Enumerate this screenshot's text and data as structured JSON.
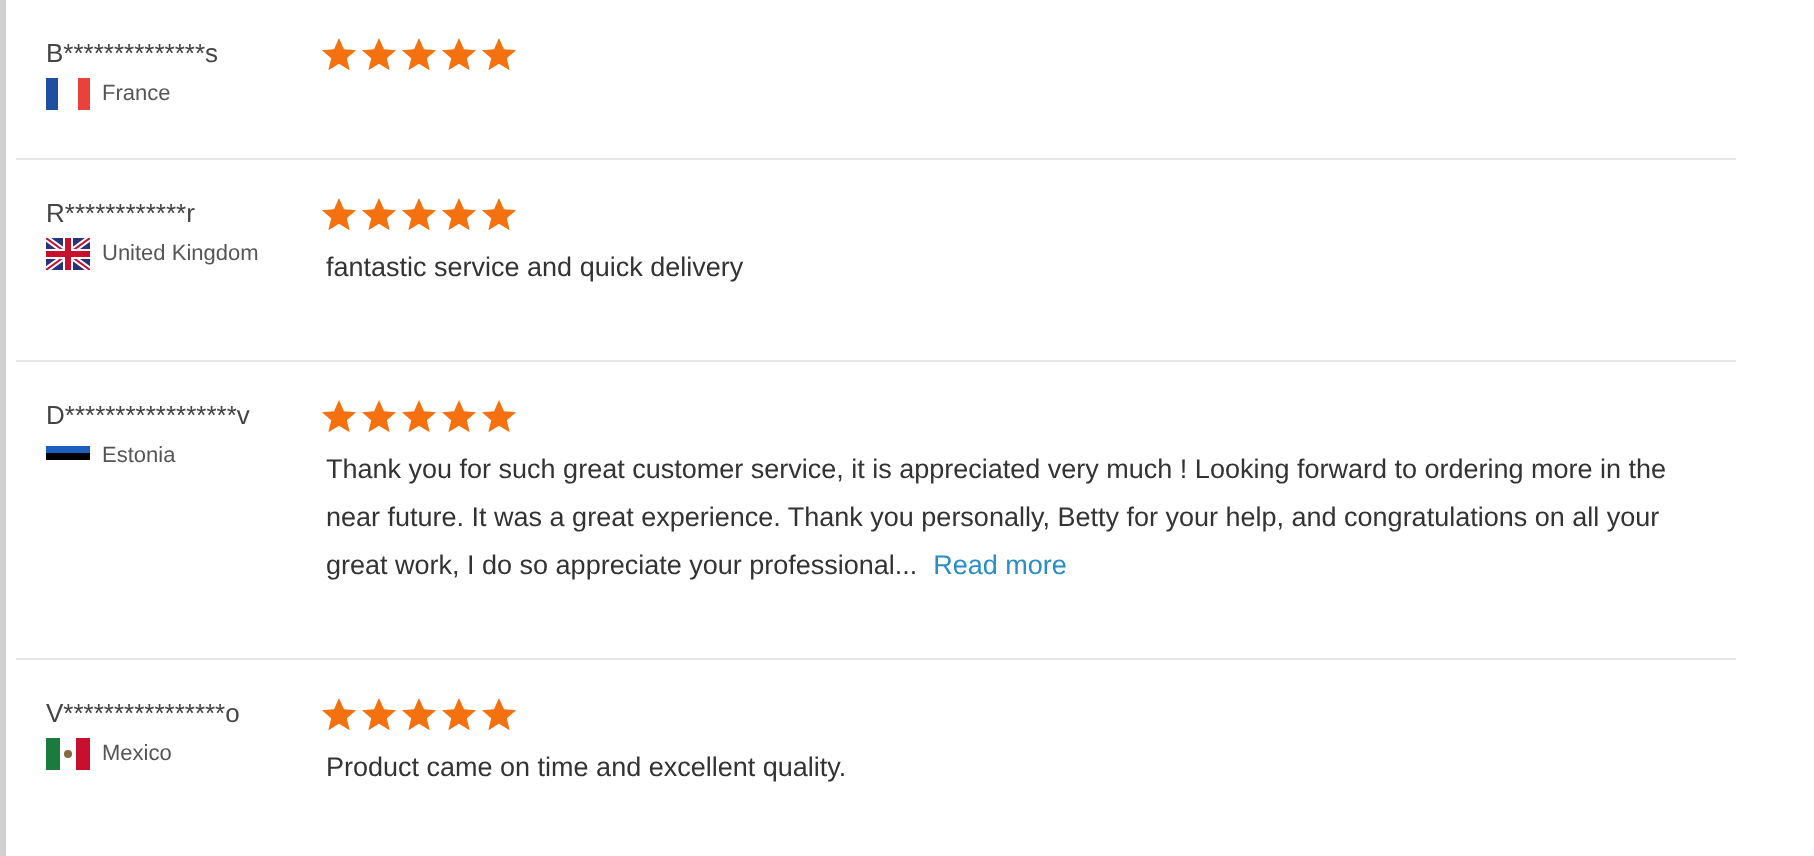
{
  "reviews": [
    {
      "name": "B**************s",
      "country": "France",
      "kind": "fr",
      "stars": 5
    },
    {
      "name": "R************r",
      "country": "United Kingdom",
      "kind": "gb",
      "stars": 5,
      "text": "fantastic service and quick delivery"
    },
    {
      "name": "D*****************v",
      "country": "Estonia",
      "kind": "ee",
      "stars": 5,
      "text": "Thank you for such great customer service, it is appreciated very much ! Looking forward to ordering more in the near future. It was a great experience. Thank you personally, Betty for your help, and congratulations on all your great work, I do so appreciate your professional...",
      "link": "Read more"
    },
    {
      "name": "V****************o",
      "country": "Mexico",
      "kind": "mx",
      "stars": 5,
      "text": "Product came on time and excellent quality."
    }
  ]
}
